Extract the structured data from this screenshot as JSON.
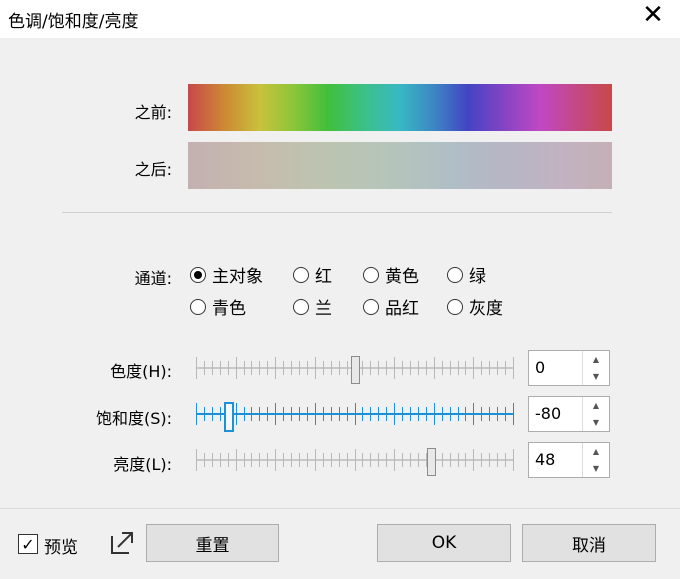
{
  "window": {
    "title": "色调/饱和度/亮度",
    "close_glyph": "✕"
  },
  "preview_bars": {
    "before_label": "之前:",
    "after_label": "之后:"
  },
  "channel": {
    "label": "通道:",
    "options": [
      "主对象",
      "红",
      "黄色",
      "绿",
      "青色",
      "兰",
      "品红",
      "灰度"
    ],
    "selected": "主对象"
  },
  "sliders": {
    "hue": {
      "label": "色度(H):",
      "value": "0",
      "min": -180,
      "max": 180
    },
    "saturation": {
      "label": "饱和度(S):",
      "value": "-80",
      "min": -100,
      "max": 100
    },
    "lightness": {
      "label": "亮度(L):",
      "value": "48",
      "min": -100,
      "max": 100
    }
  },
  "footer": {
    "preview_label": "预览",
    "preview_checked": true,
    "reset_label": "重置",
    "ok_label": "OK",
    "cancel_label": "取消"
  },
  "icons": {
    "close": "close-icon",
    "popout": "popout-icon",
    "checkmark": "checkmark-icon"
  }
}
